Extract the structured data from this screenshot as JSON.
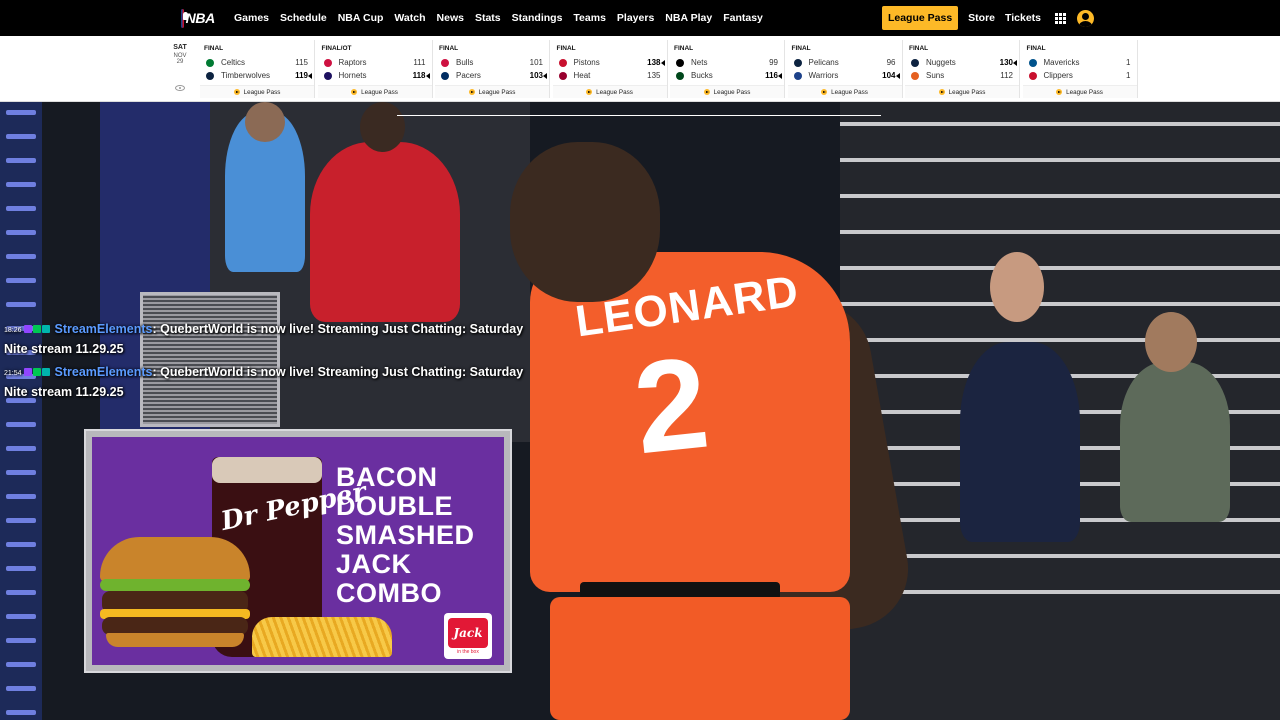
{
  "nav": {
    "logo_text": "NBA",
    "links": [
      "Games",
      "Schedule",
      "NBA Cup",
      "Watch",
      "News",
      "Stats",
      "Standings",
      "Teams",
      "Players",
      "NBA Play",
      "Fantasy"
    ],
    "league_pass": "League Pass",
    "store": "Store",
    "tickets": "Tickets"
  },
  "scores": {
    "date": {
      "day": "SAT",
      "month": "NOV",
      "num": "29"
    },
    "lp_label": "League Pass",
    "games": [
      {
        "status": "FINAL",
        "away": {
          "name": "Celtics",
          "score": "115",
          "color": "#007a33"
        },
        "home": {
          "name": "Timberwolves",
          "score": "119",
          "color": "#0c2340"
        },
        "winner": "home"
      },
      {
        "status": "FINAL/OT",
        "away": {
          "name": "Raptors",
          "score": "111",
          "color": "#ce1141"
        },
        "home": {
          "name": "Hornets",
          "score": "118",
          "color": "#1d1160"
        },
        "winner": "home"
      },
      {
        "status": "FINAL",
        "away": {
          "name": "Bulls",
          "score": "101",
          "color": "#ce1141"
        },
        "home": {
          "name": "Pacers",
          "score": "103",
          "color": "#002d62"
        },
        "winner": "home"
      },
      {
        "status": "FINAL",
        "away": {
          "name": "Pistons",
          "score": "138",
          "color": "#c8102e"
        },
        "home": {
          "name": "Heat",
          "score": "135",
          "color": "#98002e"
        },
        "winner": "away"
      },
      {
        "status": "FINAL",
        "away": {
          "name": "Nets",
          "score": "99",
          "color": "#000000"
        },
        "home": {
          "name": "Bucks",
          "score": "116",
          "color": "#00471b"
        },
        "winner": "home"
      },
      {
        "status": "FINAL",
        "away": {
          "name": "Pelicans",
          "score": "96",
          "color": "#0c2340"
        },
        "home": {
          "name": "Warriors",
          "score": "104",
          "color": "#1d428a"
        },
        "winner": "home"
      },
      {
        "status": "FINAL",
        "away": {
          "name": "Nuggets",
          "score": "130",
          "color": "#0e2240"
        },
        "home": {
          "name": "Suns",
          "score": "112",
          "color": "#e56020"
        },
        "winner": "away"
      },
      {
        "status": "FINAL",
        "away": {
          "name": "Mavericks",
          "score": "1",
          "color": "#00538c"
        },
        "home": {
          "name": "Clippers",
          "score": "1",
          "color": "#c8102e"
        },
        "winner": "none"
      }
    ]
  },
  "video": {
    "jersey_name": "LEONARD",
    "jersey_number": "2"
  },
  "chat": [
    {
      "time": "18:26",
      "user": "StreamElements",
      "text": ": QuebertWorld is now live! Streaming Just Chatting: Saturday Nite stream 11.29.25"
    },
    {
      "time": "21:54",
      "user": "StreamElements",
      "text": ": QuebertWorld is now live! Streaming Just Chatting: Saturday Nite stream 11.29.25"
    }
  ],
  "ad": {
    "brand": "Dr Pepper",
    "headline": [
      "BACON",
      "DOUBLE",
      "SMASHED",
      "JACK",
      "COMBO"
    ],
    "logo": "Jack",
    "logo_sub": "in the box"
  },
  "colors": {
    "accent": "#fdb927",
    "nav_bg": "#000000",
    "chat_user": "#5b9bff",
    "jersey": "#f35e2b"
  }
}
